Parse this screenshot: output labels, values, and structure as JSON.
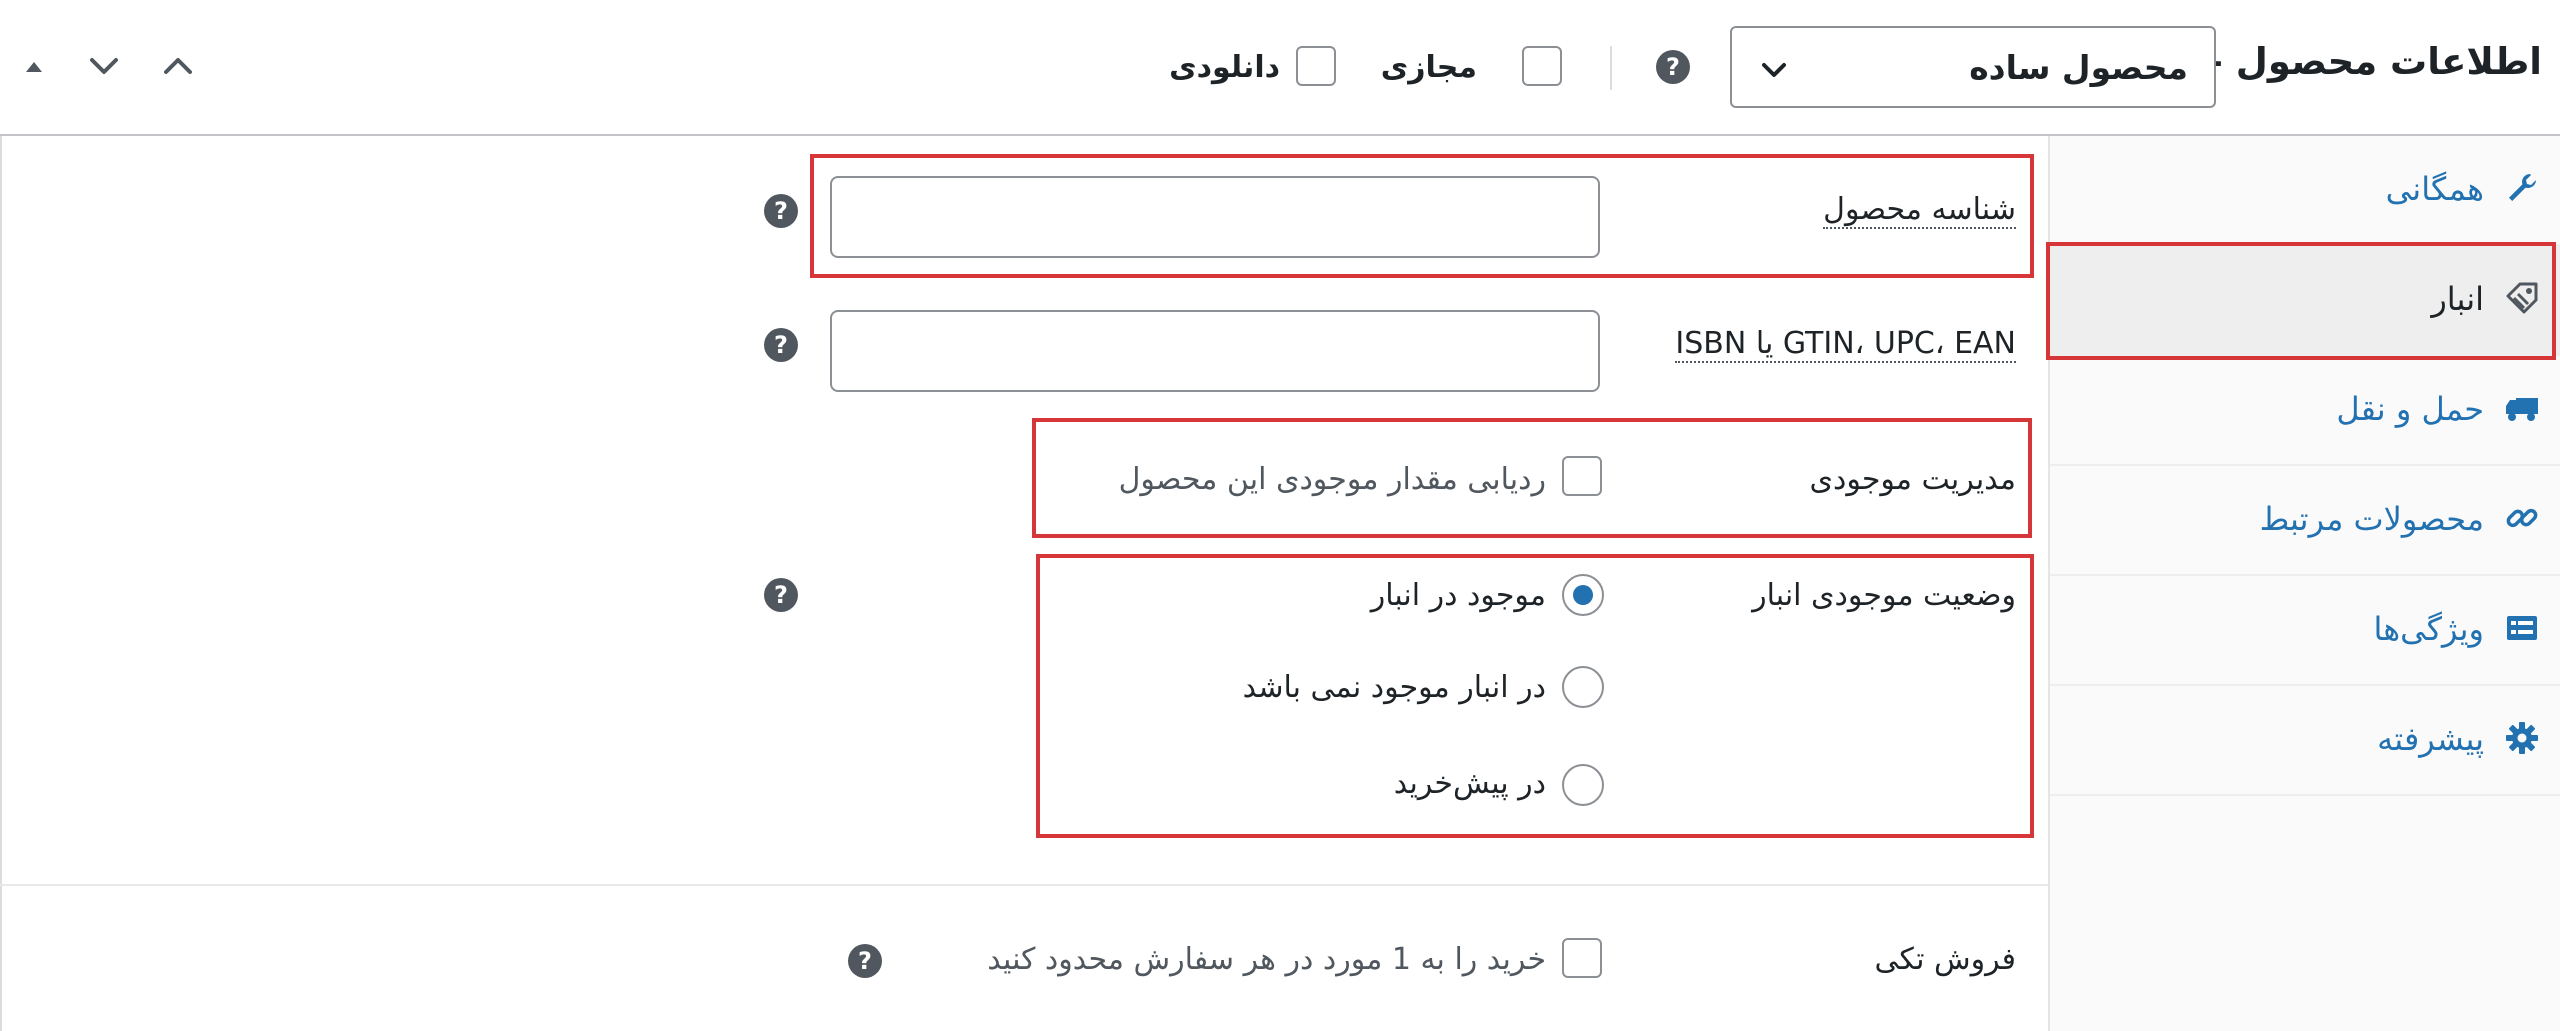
{
  "header": {
    "title": "اطلاعات محصول —",
    "product_type": "محصول ساده",
    "help_glyph": "?",
    "virtual_label": "مجازی",
    "downloadable_label": "دانلودی"
  },
  "sidebar": {
    "items": [
      {
        "label": "همگانی",
        "icon": "wrench-icon"
      },
      {
        "label": "انبار",
        "icon": "tag-icon",
        "active": true
      },
      {
        "label": "حمل و نقل",
        "icon": "truck-icon"
      },
      {
        "label": "محصولات مرتبط",
        "icon": "link-icon"
      },
      {
        "label": "ویژگی‌ها",
        "icon": "list-icon"
      },
      {
        "label": "پیشرفته",
        "icon": "gear-icon"
      }
    ]
  },
  "form": {
    "sku_label": "شناسه محصول",
    "sku_value": "",
    "gtin_label": "GTIN، UPC، EAN یا ISBN",
    "gtin_value": "",
    "manage_stock_label": "مدیریت موجودی",
    "manage_stock_checkbox_label": "ردیابی مقدار موجودی این محصول",
    "stock_status_label": "وضعیت موجودی انبار",
    "stock_status_options": [
      {
        "label": "موجود در انبار",
        "checked": true
      },
      {
        "label": "در انبار موجود نمی باشد",
        "checked": false
      },
      {
        "label": "در پیش‌خرید",
        "checked": false
      }
    ],
    "sold_individually_label": "فروش تکی",
    "sold_individually_checkbox_label": "خرید را به 1 مورد در هر سفارش محدود کنید"
  },
  "colors": {
    "accent": "#2271b1",
    "highlight": "#d63638",
    "text": "#1d2327",
    "icon_gray": "#50575e"
  }
}
